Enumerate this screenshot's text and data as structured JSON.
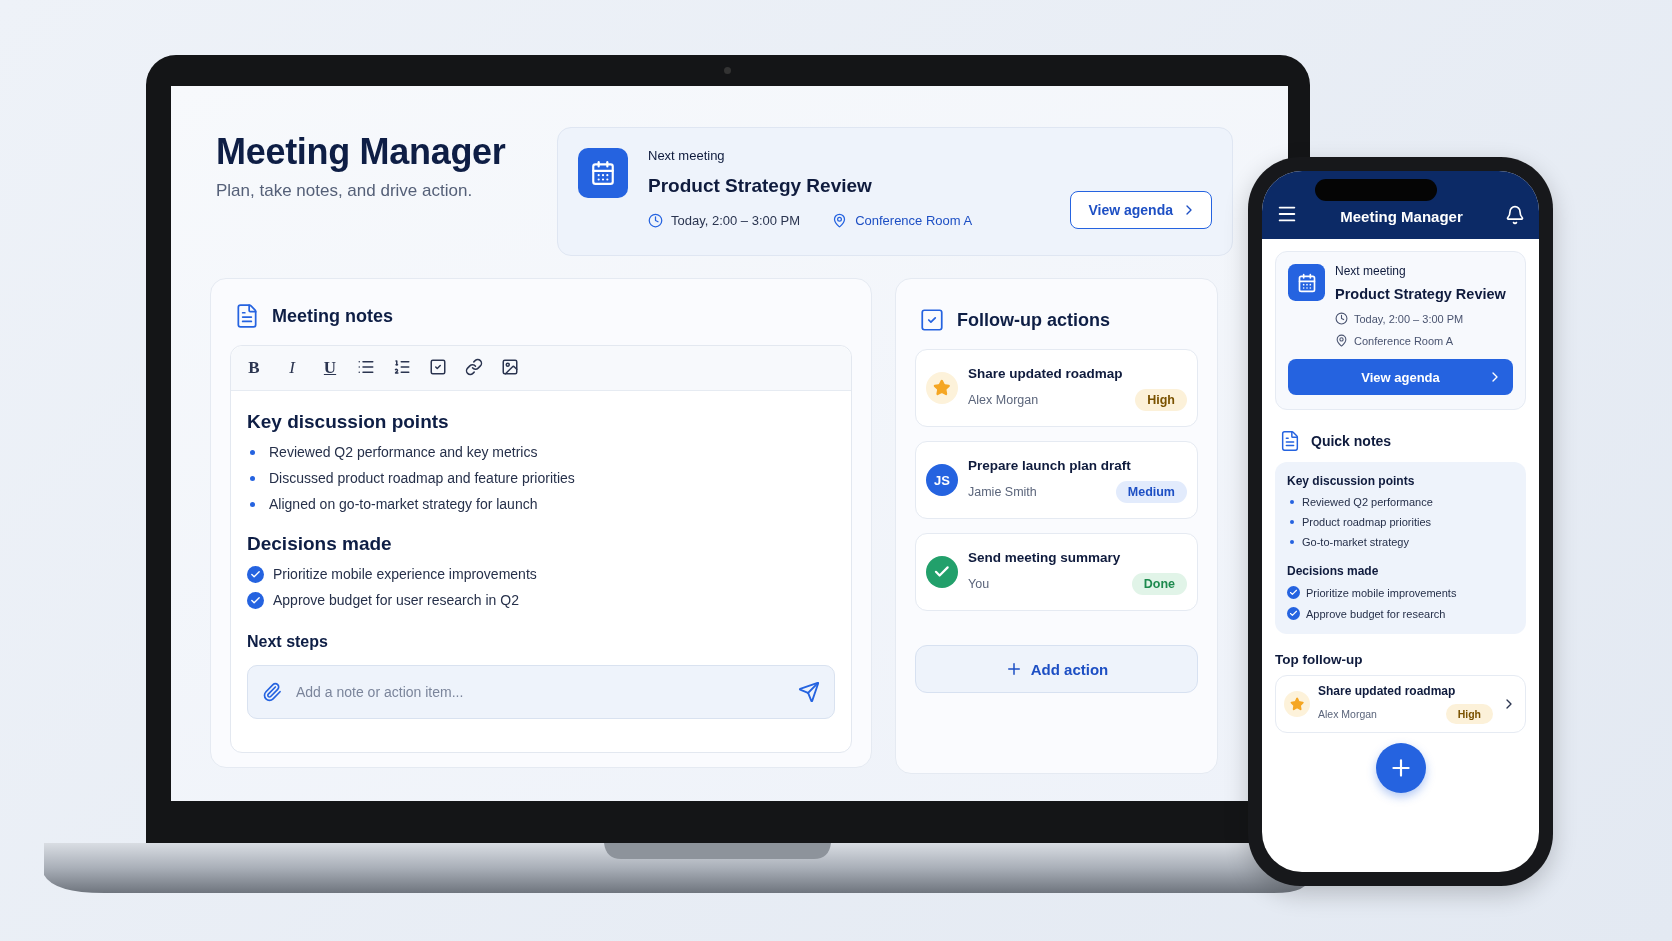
{
  "laptop": {
    "app_title": "Meeting Manager",
    "subtitle": "Plan, take notes, and drive action.",
    "next_meeting": {
      "label": "Next meeting",
      "title": "Product Strategy Review",
      "time": "Today, 2:00 – 3:00 PM",
      "location": "Conference Room A",
      "button": "View agenda"
    },
    "notes": {
      "title": "Meeting notes",
      "format_buttons": [
        "B",
        "I",
        "U"
      ],
      "key_points": {
        "heading": "Key discussion points",
        "items": [
          "Reviewed Q2 performance and key metrics",
          "Discussed product roadmap and feature priorities",
          "Aligned on go-to-market strategy for launch"
        ]
      },
      "decisions": {
        "heading": "Decisions made",
        "items": [
          {
            "text": "Prioritize mobile experience improvements",
            "checked": true
          },
          {
            "text": "Approve budget for user research in Q2",
            "checked": true
          }
        ]
      },
      "next_steps": {
        "heading": "Next steps",
        "placeholder": "Add a note or action item..."
      }
    },
    "actions": {
      "title": "Follow-up actions",
      "items": [
        {
          "title": "Share updated roadmap",
          "owner": "Alex Morgan",
          "avatar": {
            "kind": "star"
          },
          "badge": {
            "text": "High",
            "kind": "high"
          }
        },
        {
          "title": "Prepare launch plan draft",
          "owner": "Jamie Smith",
          "avatar": {
            "kind": "initials",
            "text": "JS"
          },
          "badge": {
            "text": "Medium",
            "kind": "medium"
          }
        },
        {
          "title": "Send meeting summary",
          "owner": "You",
          "avatar": {
            "kind": "done"
          },
          "badge": {
            "text": "Done",
            "kind": "done"
          }
        }
      ],
      "add_button": "Add action"
    }
  },
  "phone": {
    "app_title": "Meeting Manager",
    "next_meeting": {
      "label": "Next meeting",
      "title": "Product Strategy Review",
      "time": "Today, 2:00 – 3:00 PM",
      "location": "Conference Room A",
      "button": "View agenda"
    },
    "quick_notes": {
      "title": "Quick notes",
      "key_heading": "Key discussion points",
      "key_points": [
        "Reviewed Q2 performance",
        "Product roadmap priorities",
        "Go-to-market strategy"
      ],
      "decisions_heading": "Decisions made",
      "decisions": [
        {
          "text": "Prioritize mobile improvements",
          "checked": true
        },
        {
          "text": "Approve budget for research",
          "checked": true
        }
      ]
    },
    "top_follow_up": {
      "heading": "Top follow-up",
      "title": "Share updated roadmap",
      "owner": "Alex Morgan",
      "avatar": {
        "kind": "star"
      },
      "badge": {
        "text": "High",
        "kind": "high"
      }
    }
  }
}
